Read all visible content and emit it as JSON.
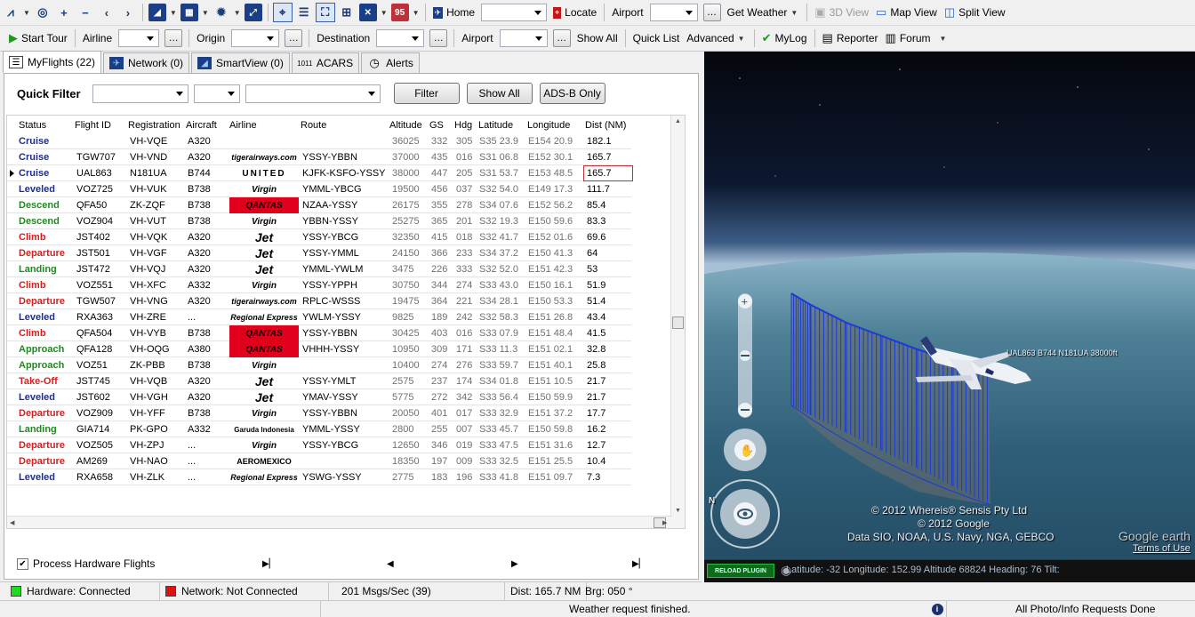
{
  "toolbar1": {
    "home_label": "Home",
    "locate_label": "Locate",
    "airport_label": "Airport",
    "get_weather_label": "Get Weather",
    "view3d_label": "3D View",
    "mapview_label": "Map View",
    "splitview_label": "Split View",
    "date_badge": "95"
  },
  "toolbar2": {
    "start_tour_label": "Start Tour",
    "airline_label": "Airline",
    "origin_label": "Origin",
    "destination_label": "Destination",
    "airport_label": "Airport",
    "show_all_label": "Show All",
    "quick_list_label": "Quick List",
    "advanced_label": "Advanced",
    "mylog_label": "MyLog",
    "reporter_label": "Reporter",
    "forum_label": "Forum"
  },
  "tabs": [
    {
      "label": "MyFlights (22)",
      "icon": "flights-list-icon"
    },
    {
      "label": "Network (0)",
      "icon": "network-plane-icon"
    },
    {
      "label": "SmartView (0)",
      "icon": "smartview-icon"
    },
    {
      "label": "ACARS",
      "icon": "acars-icon"
    },
    {
      "label": "Alerts",
      "icon": "clock-alert-icon"
    }
  ],
  "quickfilter": {
    "label": "Quick Filter",
    "filter_label": "Filter",
    "show_all_label": "Show All",
    "adsb_label": "ADS-B Only"
  },
  "columns": [
    "Status",
    "Flight ID",
    "Registration",
    "Aircraft",
    "Airline",
    "Route",
    "Altitude",
    "GS",
    "Hdg",
    "Latitude",
    "Longitude",
    "Dist (NM)"
  ],
  "colors": {
    "cruise": "#1f2e8a",
    "leveled": "#1f2e8a",
    "descend": "#1f8a1f",
    "landing": "#1f8a1f",
    "approach": "#1f8a1f",
    "climb": "#d42020",
    "departure": "#d42020",
    "takeoff": "#d42020"
  },
  "rows": [
    {
      "status": "Cruise",
      "cls": "cruise",
      "flight": "",
      "reg": "VH-VQE",
      "ac": "A320",
      "airline": "",
      "logo": "",
      "route": "",
      "alt": "36025",
      "gs": "332",
      "hdg": "305",
      "lat": "S35 23.9",
      "lon": "E154 20.9",
      "dist": "182.1"
    },
    {
      "status": "Cruise",
      "cls": "cruise",
      "flight": "TGW707",
      "reg": "VH-VND",
      "ac": "A320",
      "airline": "tigerairways.com",
      "logo": "tig",
      "route": "YSSY-YBBN",
      "alt": "37000",
      "gs": "435",
      "hdg": "016",
      "lat": "S31 06.8",
      "lon": "E152 30.1",
      "dist": "165.7"
    },
    {
      "status": "Cruise",
      "cls": "cruise",
      "flight": "UAL863",
      "reg": "N181UA",
      "ac": "B744",
      "airline": "UNITED",
      "logo": "unt",
      "route": "KJFK-KSFO-YSSY",
      "alt": "38000",
      "gs": "447",
      "hdg": "205",
      "lat": "S31 53.7",
      "lon": "E153 48.5",
      "dist": "165.7",
      "selected": true
    },
    {
      "status": "Leveled",
      "cls": "leveled",
      "flight": "VOZ725",
      "reg": "VH-VUK",
      "ac": "B738",
      "airline": "Virgin",
      "logo": "vir",
      "route": "YMML-YBCG",
      "alt": "19500",
      "gs": "456",
      "hdg": "037",
      "lat": "S32 54.0",
      "lon": "E149 17.3",
      "dist": "111.7"
    },
    {
      "status": "Descend",
      "cls": "descend",
      "flight": "QFA50",
      "reg": "ZK-ZQF",
      "ac": "B738",
      "airline": "QANTAS",
      "logo": "qan",
      "route": "NZAA-YSSY",
      "alt": "26175",
      "gs": "355",
      "hdg": "278",
      "lat": "S34 07.6",
      "lon": "E152 56.2",
      "dist": "85.4"
    },
    {
      "status": "Descend",
      "cls": "descend",
      "flight": "VOZ904",
      "reg": "VH-VUT",
      "ac": "B738",
      "airline": "Virgin",
      "logo": "vir",
      "route": "YBBN-YSSY",
      "alt": "25275",
      "gs": "365",
      "hdg": "201",
      "lat": "S32 19.3",
      "lon": "E150 59.6",
      "dist": "83.3"
    },
    {
      "status": "Climb",
      "cls": "climb",
      "flight": "JST402",
      "reg": "VH-VQK",
      "ac": "A320",
      "airline": "Jet",
      "logo": "jet",
      "route": "YSSY-YBCG",
      "alt": "32350",
      "gs": "415",
      "hdg": "018",
      "lat": "S32 41.7",
      "lon": "E152 01.6",
      "dist": "69.6"
    },
    {
      "status": "Departure",
      "cls": "departure",
      "flight": "JST501",
      "reg": "VH-VGF",
      "ac": "A320",
      "airline": "Jet",
      "logo": "jet",
      "route": "YSSY-YMML",
      "alt": "24150",
      "gs": "366",
      "hdg": "233",
      "lat": "S34 37.2",
      "lon": "E150 41.3",
      "dist": "64"
    },
    {
      "status": "Landing",
      "cls": "landing",
      "flight": "JST472",
      "reg": "VH-VQJ",
      "ac": "A320",
      "airline": "Jet",
      "logo": "jet",
      "route": "YMML-YWLM",
      "alt": "3475",
      "gs": "226",
      "hdg": "333",
      "lat": "S32 52.0",
      "lon": "E151 42.3",
      "dist": "53"
    },
    {
      "status": "Climb",
      "cls": "climb",
      "flight": "VOZ551",
      "reg": "VH-XFC",
      "ac": "A332",
      "airline": "Virgin",
      "logo": "vir",
      "route": "YSSY-YPPH",
      "alt": "30750",
      "gs": "344",
      "hdg": "274",
      "lat": "S33 43.0",
      "lon": "E150 16.1",
      "dist": "51.9"
    },
    {
      "status": "Departure",
      "cls": "departure",
      "flight": "TGW507",
      "reg": "VH-VNG",
      "ac": "A320",
      "airline": "tigerairways.com",
      "logo": "tig",
      "route": "RPLC-WSSS",
      "alt": "19475",
      "gs": "364",
      "hdg": "221",
      "lat": "S34 28.1",
      "lon": "E150 53.3",
      "dist": "51.4"
    },
    {
      "status": "Leveled",
      "cls": "leveled",
      "flight": "RXA363",
      "reg": "VH-ZRE",
      "ac": "...",
      "airline": "Regional Express",
      "logo": "rex",
      "route": "YWLM-YSSY",
      "alt": "9825",
      "gs": "189",
      "hdg": "242",
      "lat": "S32 58.3",
      "lon": "E151 26.8",
      "dist": "43.4"
    },
    {
      "status": "Climb",
      "cls": "climb",
      "flight": "QFA504",
      "reg": "VH-VYB",
      "ac": "B738",
      "airline": "QANTAS",
      "logo": "qan",
      "route": "YSSY-YBBN",
      "alt": "30425",
      "gs": "403",
      "hdg": "016",
      "lat": "S33 07.9",
      "lon": "E151 48.4",
      "dist": "41.5"
    },
    {
      "status": "Approach",
      "cls": "approach",
      "flight": "QFA128",
      "reg": "VH-OQG",
      "ac": "A380",
      "airline": "QANTAS",
      "logo": "qan",
      "route": "VHHH-YSSY",
      "alt": "10950",
      "gs": "309",
      "hdg": "171",
      "lat": "S33 11.3",
      "lon": "E151 02.1",
      "dist": "32.8"
    },
    {
      "status": "Approach",
      "cls": "approach",
      "flight": "VOZ51",
      "reg": "ZK-PBB",
      "ac": "B738",
      "airline": "Virgin",
      "logo": "vir",
      "route": "",
      "alt": "10400",
      "gs": "274",
      "hdg": "276",
      "lat": "S33 59.7",
      "lon": "E151 40.1",
      "dist": "25.8"
    },
    {
      "status": "Take-Off",
      "cls": "takeoff",
      "flight": "JST745",
      "reg": "VH-VQB",
      "ac": "A320",
      "airline": "Jet",
      "logo": "jet",
      "route": "YSSY-YMLT",
      "alt": "2575",
      "gs": "237",
      "hdg": "174",
      "lat": "S34 01.8",
      "lon": "E151 10.5",
      "dist": "21.7"
    },
    {
      "status": "Leveled",
      "cls": "leveled",
      "flight": "JST602",
      "reg": "VH-VGH",
      "ac": "A320",
      "airline": "Jet",
      "logo": "jet",
      "route": "YMAV-YSSY",
      "alt": "5775",
      "gs": "272",
      "hdg": "342",
      "lat": "S33 56.4",
      "lon": "E150 59.9",
      "dist": "21.7"
    },
    {
      "status": "Departure",
      "cls": "departure",
      "flight": "VOZ909",
      "reg": "VH-YFF",
      "ac": "B738",
      "airline": "Virgin",
      "logo": "vir",
      "route": "YSSY-YBBN",
      "alt": "20050",
      "gs": "401",
      "hdg": "017",
      "lat": "S33 32.9",
      "lon": "E151 37.2",
      "dist": "17.7"
    },
    {
      "status": "Landing",
      "cls": "landing",
      "flight": "GIA714",
      "reg": "PK-GPO",
      "ac": "A332",
      "airline": "Garuda Indonesia",
      "logo": "gar",
      "route": "YMML-YSSY",
      "alt": "2800",
      "gs": "255",
      "hdg": "007",
      "lat": "S33 45.7",
      "lon": "E150 59.8",
      "dist": "16.2"
    },
    {
      "status": "Departure",
      "cls": "departure",
      "flight": "VOZ505",
      "reg": "VH-ZPJ",
      "ac": "...",
      "airline": "Virgin",
      "logo": "vir",
      "route": "YSSY-YBCG",
      "alt": "12650",
      "gs": "346",
      "hdg": "019",
      "lat": "S33 47.5",
      "lon": "E151 31.6",
      "dist": "12.7"
    },
    {
      "status": "Departure",
      "cls": "departure",
      "flight": "AM269",
      "reg": "VH-NAO",
      "ac": "...",
      "airline": "AEROMEXICO",
      "logo": "aer",
      "route": "",
      "alt": "18350",
      "gs": "197",
      "hdg": "009",
      "lat": "S33 32.5",
      "lon": "E151 25.5",
      "dist": "10.4"
    },
    {
      "status": "Leveled",
      "cls": "leveled",
      "flight": "RXA658",
      "reg": "VH-ZLK",
      "ac": "...",
      "airline": "Regional Express",
      "logo": "rex",
      "route": "YSWG-YSSY",
      "alt": "2775",
      "gs": "183",
      "hdg": "196",
      "lat": "S33 41.8",
      "lon": "E151 09.7",
      "dist": "7.3"
    }
  ],
  "bottom": {
    "process_hw_label": "Process Hardware Flights",
    "process_hw_checked": true
  },
  "statusbar": {
    "hardware": "Hardware: Connected",
    "hardware_color": "#1fdc1f",
    "network": "Network: Not Connected",
    "network_color": "#e01010",
    "msgs": "201 Msgs/Sec (39)",
    "dist": "Dist: 165.7 NM",
    "brg": "Brg: 050 °"
  },
  "status2": {
    "weather": "Weather request finished.",
    "photo": "All Photo/Info Requests Done"
  },
  "map": {
    "aircraft_label": "UAL863 B744 N181UA 38000ft",
    "copyright1": "© 2012 Whereis® Sensis Pty Ltd",
    "copyright2": "© 2012 Google",
    "copyright3": "Data SIO, NOAA, U.S. Navy, NGA, GEBCO",
    "google_logo": "Google earth",
    "terms": "Terms of Use",
    "reload_label": "RELOAD PLUGIN",
    "coords": "Latitude: -32  Longitude: 152.99  Altitude 68824  Heading: 76  Tilt:",
    "compass_n": "N"
  }
}
